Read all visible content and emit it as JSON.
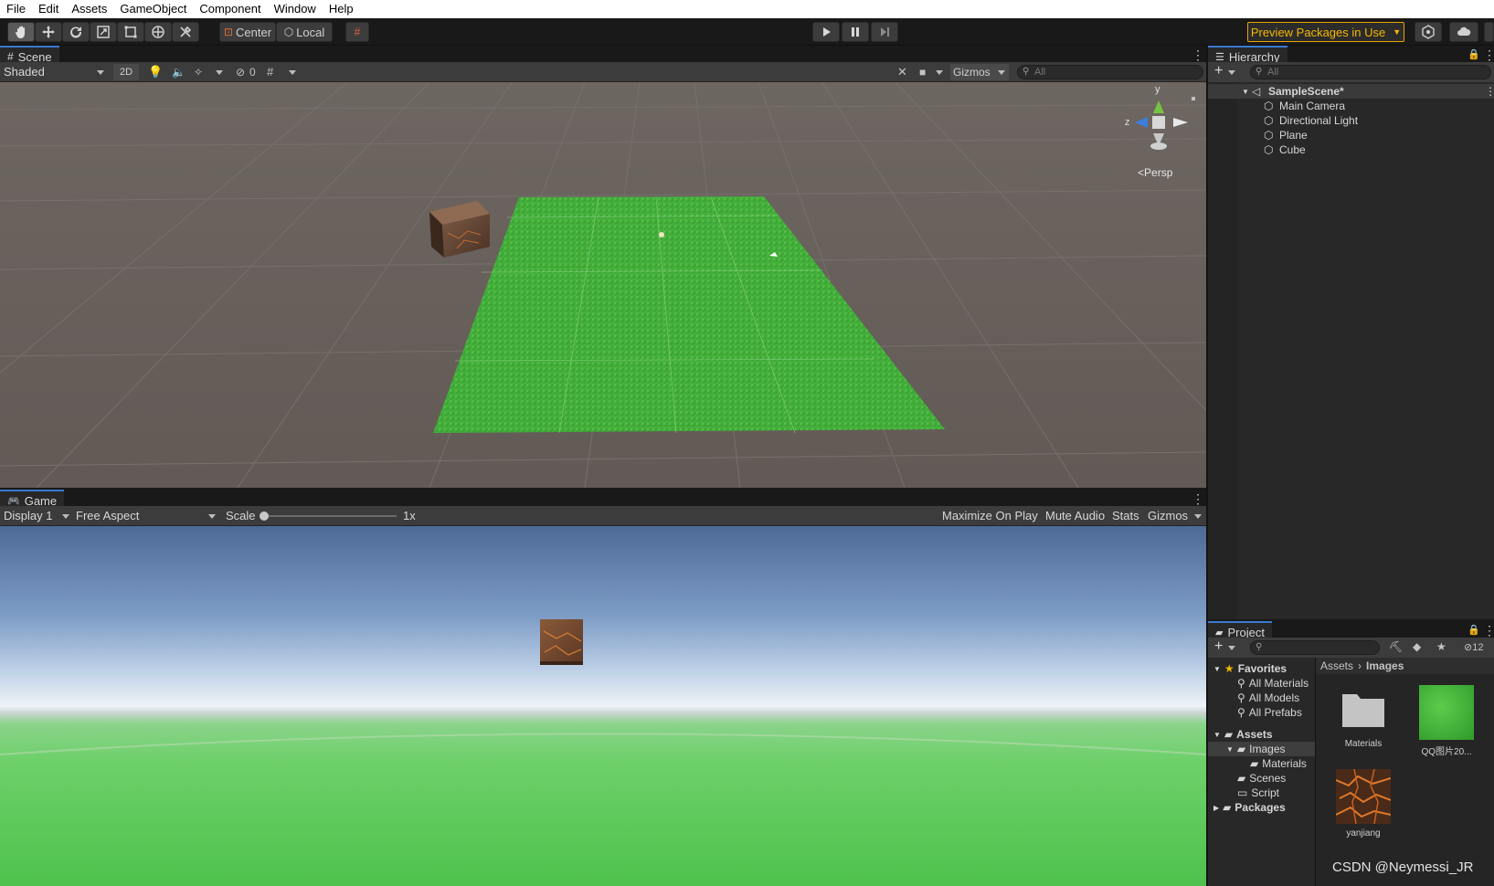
{
  "menu": [
    "File",
    "Edit",
    "Assets",
    "GameObject",
    "Component",
    "Window",
    "Help"
  ],
  "toolbar": {
    "pivot_label": "Center",
    "space_label": "Local",
    "preview_packages": "Preview Packages in Use"
  },
  "scene": {
    "tab": "Scene",
    "draw_mode": "Shaded",
    "twod": "2D",
    "hidden_count": "0",
    "gizmos": "Gizmos",
    "search_placeholder": "All",
    "persp_label": "Persp",
    "axis_y": "y",
    "axis_z": "z"
  },
  "game": {
    "tab": "Game",
    "display": "Display 1",
    "aspect": "Free Aspect",
    "scale_label": "Scale",
    "scale_value": "1x",
    "maximize": "Maximize On Play",
    "mute": "Mute Audio",
    "stats": "Stats",
    "gizmos": "Gizmos"
  },
  "hierarchy": {
    "tab": "Hierarchy",
    "search_placeholder": "All",
    "scene_name": "SampleScene*",
    "items": [
      "Main Camera",
      "Directional Light",
      "Plane",
      "Cube"
    ]
  },
  "project": {
    "tab": "Project",
    "hidden_count": "12",
    "favorites_label": "Favorites",
    "favorites": [
      "All Materials",
      "All Models",
      "All Prefabs"
    ],
    "assets_label": "Assets",
    "images_label": "Images",
    "materials_label": "Materials",
    "scenes_label": "Scenes",
    "script_label": "Script",
    "packages_label": "Packages",
    "breadcrumb_root": "Assets",
    "breadcrumb_current": "Images",
    "assets": [
      {
        "name": "Materials",
        "kind": "folder"
      },
      {
        "name": "QQ图片20...",
        "kind": "grass-texture"
      },
      {
        "name": "yanjiang",
        "kind": "lava-texture"
      }
    ]
  },
  "watermark": "CSDN @Neymessi_JR",
  "colors": {
    "accent_tab": "#3a7ad0",
    "preview_orange": "#f5b800",
    "scene_bg": "#6a625c",
    "grass": "#4cb83e"
  }
}
